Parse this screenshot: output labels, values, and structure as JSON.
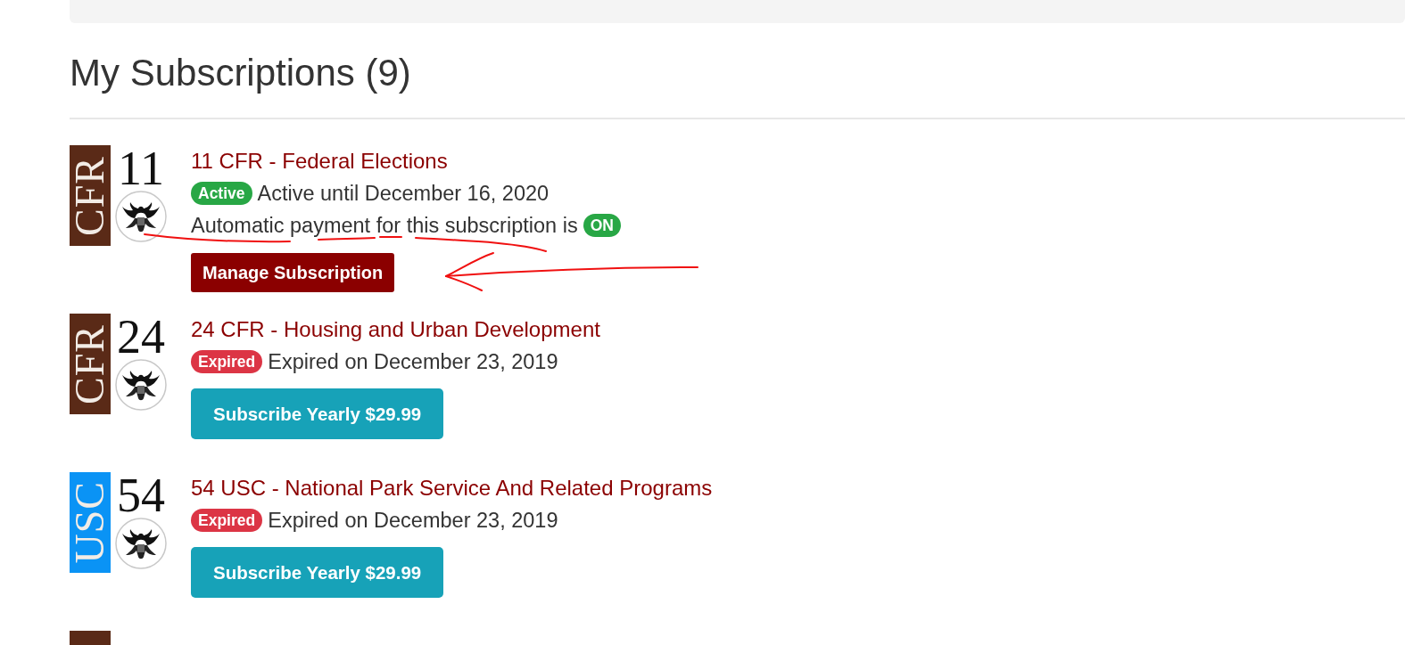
{
  "heading": "My Subscriptions (9)",
  "subscriptions": [
    {
      "title": "11 CFR - Federal Elections",
      "logo": {
        "code": "CFR",
        "number": "11",
        "color": "#5a2a17"
      },
      "kind": "active",
      "badge": "Active",
      "status_text": "Active until December 16, 2020",
      "autopay": {
        "text": "Automatic payment for this subscription is",
        "toggle": "ON"
      },
      "button": "Manage Subscription"
    },
    {
      "title": "24 CFR - Housing and Urban Development",
      "logo": {
        "code": "CFR",
        "number": "24",
        "color": "#5a2a17"
      },
      "kind": "expired",
      "badge": "Expired",
      "status_text": "Expired on December 23, 2019",
      "button": "Subscribe Yearly $29.99"
    },
    {
      "title": "54 USC - National Park Service And Related Programs",
      "logo": {
        "code": "USC",
        "number": "54",
        "color": "#0a93f5"
      },
      "kind": "expired",
      "badge": "Expired",
      "status_text": "Expired on December 23, 2019",
      "button": "Subscribe Yearly $29.99"
    },
    {
      "logo": {
        "color": "#5a2a17"
      }
    }
  ]
}
